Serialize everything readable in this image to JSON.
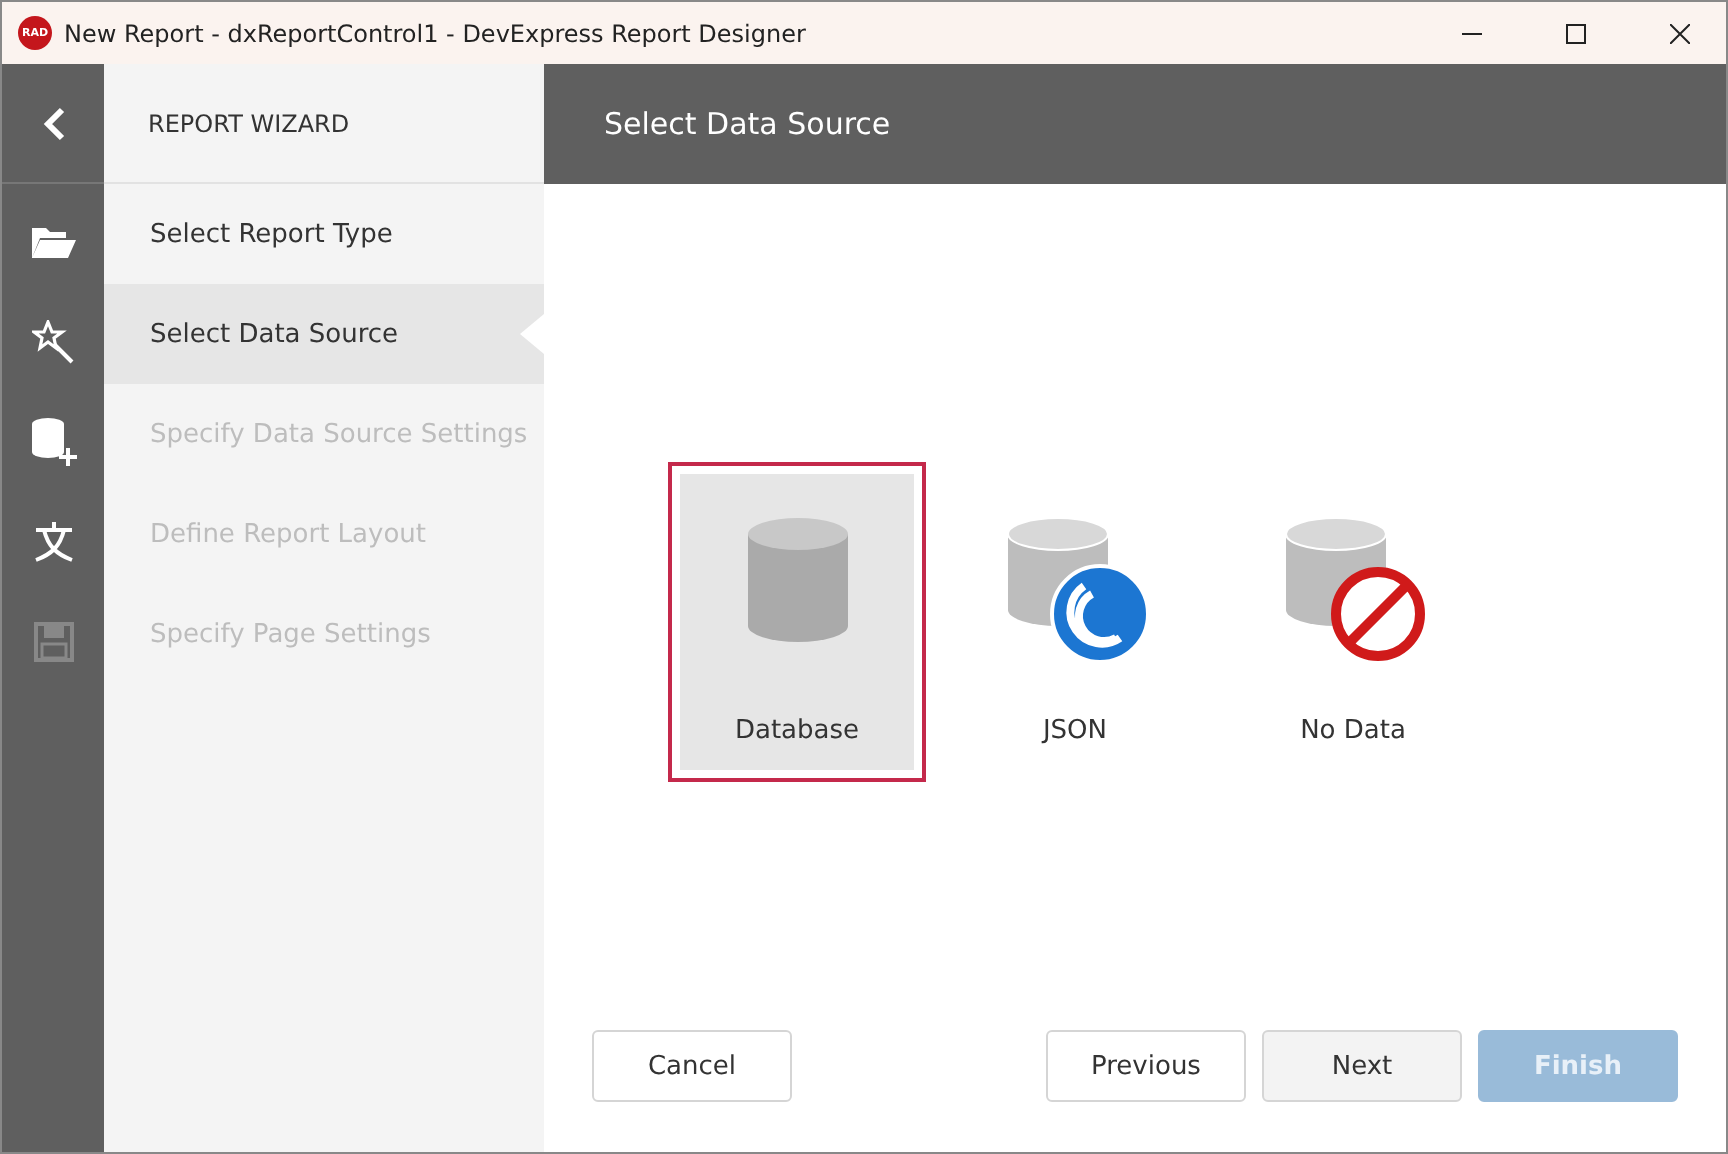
{
  "window": {
    "title": "New Report - dxReportControl1 - DevExpress Report Designer",
    "app_badge": "RAD"
  },
  "rail": [
    {
      "kind": "back",
      "disabled": false
    },
    {
      "kind": "folder",
      "disabled": false
    },
    {
      "kind": "wand",
      "disabled": false
    },
    {
      "kind": "database",
      "disabled": false
    },
    {
      "kind": "text",
      "disabled": false
    },
    {
      "kind": "save",
      "disabled": true
    }
  ],
  "wizard": {
    "title": "REPORT WIZARD",
    "steps": [
      {
        "label": "Select Report Type",
        "selected": false,
        "disabled": false
      },
      {
        "label": "Select Data Source",
        "selected": true,
        "disabled": false
      },
      {
        "label": "Specify Data Source Settings",
        "selected": false,
        "disabled": true
      },
      {
        "label": "Define Report Layout",
        "selected": false,
        "disabled": true
      },
      {
        "label": "Specify Page Settings",
        "selected": false,
        "disabled": true
      }
    ]
  },
  "header": {
    "title": "Select Data Source"
  },
  "sources": [
    {
      "kind": "database",
      "label": "Database",
      "selected": true
    },
    {
      "kind": "json",
      "label": "JSON",
      "selected": false
    },
    {
      "kind": "none",
      "label": "No Data",
      "selected": false
    }
  ],
  "buttons": [
    {
      "label": "Cancel",
      "disabled": false,
      "hovered": false
    },
    {
      "label": "Previous",
      "disabled": false,
      "hovered": false
    },
    {
      "label": "Next",
      "disabled": false,
      "hovered": true
    },
    {
      "label": "Finish",
      "disabled": true,
      "hovered": false
    }
  ]
}
